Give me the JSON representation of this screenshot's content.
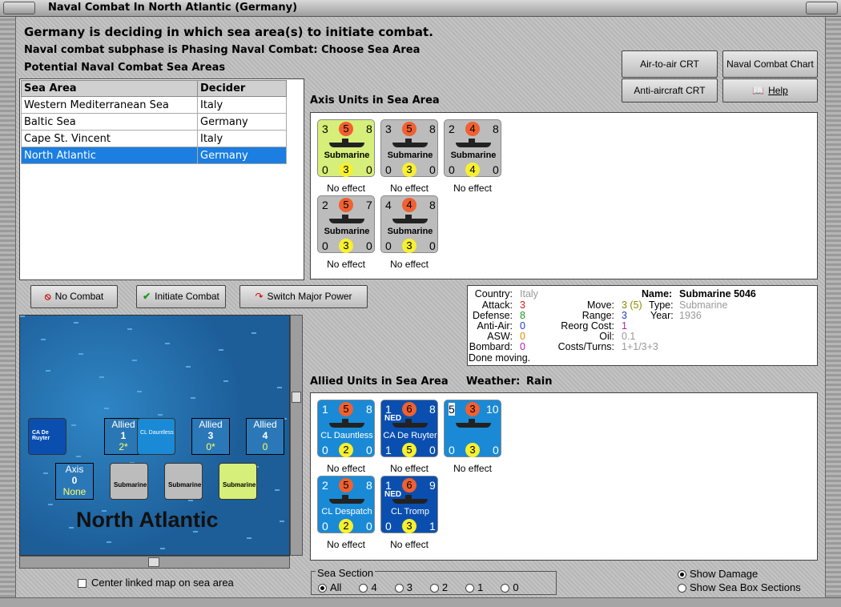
{
  "window": {
    "title": "Naval Combat In North Atlantic (Germany)"
  },
  "header": {
    "line1": "Germany is deciding in which sea area(s) to initiate combat.",
    "line2": "Naval combat subphase is Phasing Naval Combat: Choose Sea Area",
    "line3": "Potential Naval Combat Sea Areas"
  },
  "buttons": {
    "air_to_air": "Air-to-air CRT",
    "naval_chart": "Naval Combat Chart",
    "anti_aircraft": "Anti-aircraft CRT",
    "help": "Help",
    "no_combat": "No Combat",
    "initiate": "Initiate Combat",
    "switch": "Switch Major Power"
  },
  "table": {
    "headers": [
      "Sea Area",
      "Decider"
    ],
    "rows": [
      [
        "Western Mediterranean Sea",
        "Italy"
      ],
      [
        "Baltic Sea",
        "Germany"
      ],
      [
        "Cape St. Vincent",
        "Italy"
      ],
      [
        "North Atlantic",
        "Germany"
      ]
    ],
    "selected": 3
  },
  "axis": {
    "title": "Axis Units in Sea Area",
    "units": [
      {
        "tl": "3",
        "tc": "5",
        "tr": "8",
        "name": "Submarine",
        "bl": "0",
        "bc": "3",
        "br": "0",
        "bg": "#d6ee7a",
        "note": "No effect"
      },
      {
        "tl": "3",
        "tc": "5",
        "tr": "8",
        "name": "Submarine",
        "bl": "0",
        "bc": "3",
        "br": "0",
        "bg": "#bcbcbc",
        "note": "No effect"
      },
      {
        "tl": "2",
        "tc": "4",
        "tr": "8",
        "name": "Submarine",
        "bl": "0",
        "bc": "4",
        "br": "0",
        "bg": "#bcbcbc",
        "note": "No effect"
      },
      {
        "tl": "2",
        "tc": "5",
        "tr": "7",
        "name": "Submarine",
        "bl": "0",
        "bc": "3",
        "br": "0",
        "bg": "#bcbcbc",
        "note": "No effect"
      },
      {
        "tl": "4",
        "tc": "4",
        "tr": "8",
        "name": "Submarine",
        "bl": "0",
        "bc": "3",
        "br": "0",
        "bg": "#bcbcbc",
        "note": "No effect"
      }
    ]
  },
  "allied": {
    "title": "Allied Units in Sea Area",
    "weather_label": "Weather:",
    "weather": "Rain",
    "units": [
      {
        "tl": "1",
        "tc": "5",
        "tr": "8",
        "tag": "",
        "name": "CL Dauntless",
        "bl": "0",
        "bc": "2",
        "br": "0",
        "bg": "#1a8ad6",
        "note": "No effect"
      },
      {
        "tl": "1",
        "tc": "6",
        "tr": "8",
        "tag": "NED",
        "name": "CA De Ruyter",
        "bl": "1",
        "bc": "5",
        "br": "0",
        "bg": "#0a4fb0",
        "note": "No effect"
      },
      {
        "tl": "5",
        "tc": "3",
        "tr": "10",
        "tag": "",
        "name": "",
        "bl": "0",
        "bc": "3",
        "br": "0",
        "bg": "#1a8ad6",
        "note": "No effect"
      },
      {
        "tl": "2",
        "tc": "5",
        "tr": "8",
        "tag": "",
        "name": "CL Despatch",
        "bl": "0",
        "bc": "2",
        "br": "0",
        "bg": "#1a8ad6",
        "note": "No effect"
      },
      {
        "tl": "1",
        "tc": "6",
        "tr": "9",
        "tag": "NED",
        "name": "CL Tromp",
        "bl": "0",
        "bc": "3",
        "br": "1",
        "bg": "#0a4fb0",
        "note": "No effect"
      }
    ]
  },
  "info": {
    "country_l": "Country:",
    "country": "Italy",
    "attack_l": "Attack:",
    "attack": "3",
    "defense_l": "Defense:",
    "defense": "8",
    "aa_l": "Anti-Air:",
    "aa": "0",
    "asw_l": "ASW:",
    "asw": "0",
    "bombard_l": "Bombard:",
    "bombard": "0",
    "status": "Done moving.",
    "name_l": "Name:",
    "name": "Submarine 5046",
    "move_l": "Move:",
    "move": "3 (5)",
    "type_l": "Type:",
    "type": "Submarine",
    "range_l": "Range:",
    "range": "3",
    "year_l": "Year:",
    "year": "1936",
    "reorg_l": "Reorg Cost:",
    "reorg": "1",
    "oil_l": "Oil:",
    "oil": "0.1",
    "cost_l": "Costs/Turns:",
    "cost": "1+1/3+3"
  },
  "map": {
    "area_name": "North Atlantic",
    "boxes": [
      {
        "t": "Allied",
        "v": "1",
        "s": "2*"
      },
      {
        "t": "Allied",
        "v": "3",
        "s": "0*"
      },
      {
        "t": "Allied",
        "v": "4",
        "s": "0"
      }
    ],
    "axis_box": {
      "t": "Axis",
      "v": "0",
      "s": "None"
    },
    "center_label": "Center linked map on sea area"
  },
  "sea_section": {
    "title": "Sea Section",
    "options": [
      "All",
      "4",
      "3",
      "2",
      "1",
      "0"
    ]
  },
  "show": {
    "damage": "Show Damage",
    "sections": "Show Sea Box Sections"
  }
}
